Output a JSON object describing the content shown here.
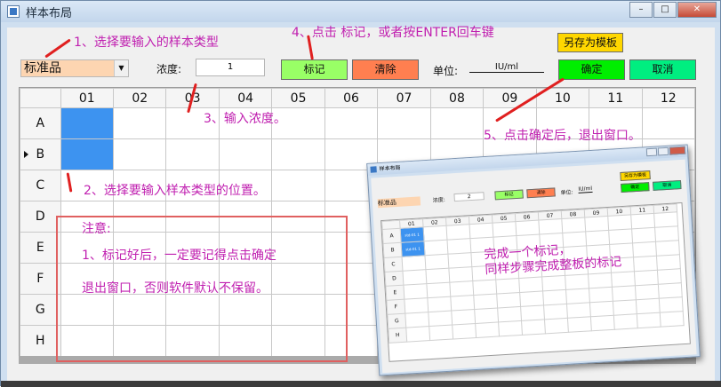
{
  "window": {
    "title": "样本布局",
    "min_label": "–",
    "max_label": "□",
    "close_label": "✕"
  },
  "toolbar": {
    "sample_type_value": "标准品",
    "concentration_label": "浓度:",
    "concentration_value": "1",
    "mark_label": "标记",
    "clear_label": "清除",
    "unit_label": "单位:",
    "unit_value": "IU/ml",
    "save_template_label": "另存为模板",
    "ok_label": "确定",
    "cancel_label": "取消"
  },
  "colors": {
    "mark_button": "#99ff66",
    "clear_button": "#ff7f50",
    "save_template_button": "#ffd700",
    "ok_button": "#00ee00",
    "cancel_button": "#00ee80",
    "selected_cell": "#3d93f0",
    "annotation": "#c020b0"
  },
  "grid": {
    "columns": [
      "01",
      "02",
      "03",
      "04",
      "05",
      "06",
      "07",
      "08",
      "09",
      "10",
      "11",
      "12"
    ],
    "rows": [
      "A",
      "B",
      "C",
      "D",
      "E",
      "F",
      "G",
      "H"
    ],
    "selected_cells": [
      "A01",
      "B01"
    ]
  },
  "annotations": {
    "step1": "1、选择要输入的样本类型",
    "step2": "2、选择要输入样本类型的位置。",
    "step3": "3、输入浓度。",
    "step4": "4、点击 标记，或者按ENTER回车键",
    "step5": "5、点击确定后，退出窗口。",
    "note_title": "注意:",
    "note_line1": "1、标记好后，一定要记得点击确定",
    "note_line2": "退出窗口，否则软件默认不保留。"
  },
  "inset": {
    "title": "样本布局",
    "sample_type_value": "标准品",
    "concentration_label": "浓度:",
    "concentration_value": "2",
    "mark_label": "标记",
    "clear_label": "清除",
    "unit_label": "单位:",
    "unit_value": "IU/ml",
    "save_template_label": "另存为模板",
    "ok_label": "确定",
    "cancel_label": "取消",
    "columns": [
      "01",
      "02",
      "03",
      "04",
      "05",
      "06",
      "07",
      "08",
      "09",
      "10",
      "11",
      "12"
    ],
    "rows": [
      "A",
      "B",
      "C",
      "D",
      "E",
      "F",
      "G",
      "H"
    ],
    "cell_a01": "std-01 1",
    "cell_b01": "std-01 1",
    "note_line1": "完成一个标记，",
    "note_line2": "同样步骤完成整板的标记"
  }
}
